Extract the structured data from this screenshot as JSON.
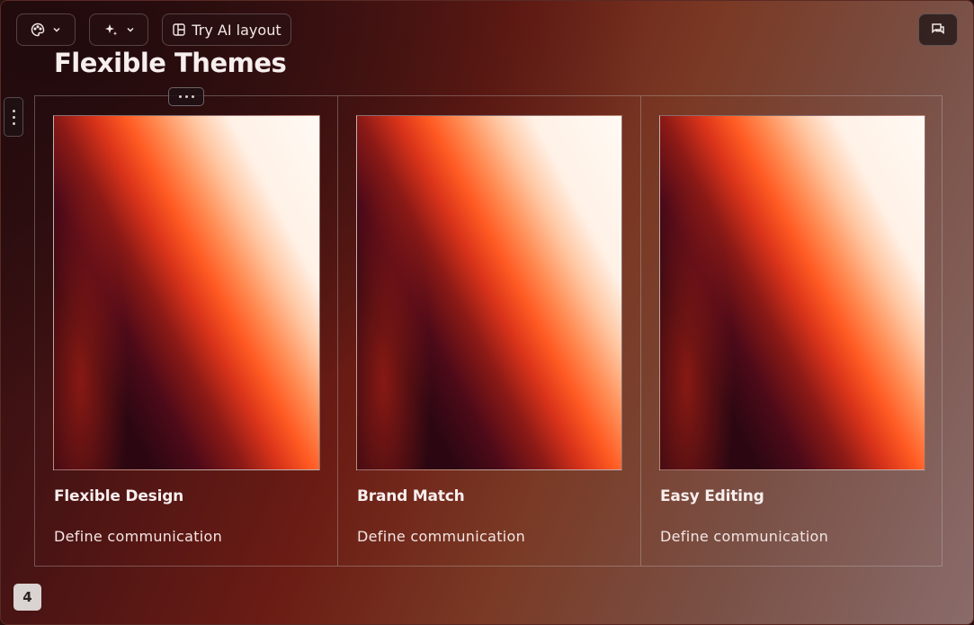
{
  "toolbar": {
    "theme_icon": "palette-icon",
    "ai_icon": "sparkle-icon",
    "layout_icon": "layout-icon",
    "layout_label": "Try AI layout",
    "comment_icon": "comment-icon"
  },
  "slide": {
    "title": "Flexible Themes",
    "page_number": "4",
    "cards": [
      {
        "title": "Flexible Design",
        "description": "Define communication"
      },
      {
        "title": "Brand Match",
        "description": "Define communication"
      },
      {
        "title": "Easy Editing",
        "description": "Define communication"
      }
    ]
  },
  "colors": {
    "accent_orange": "#ff5a22",
    "deep_maroon": "#2c0712",
    "text_light": "#f7eeee"
  }
}
